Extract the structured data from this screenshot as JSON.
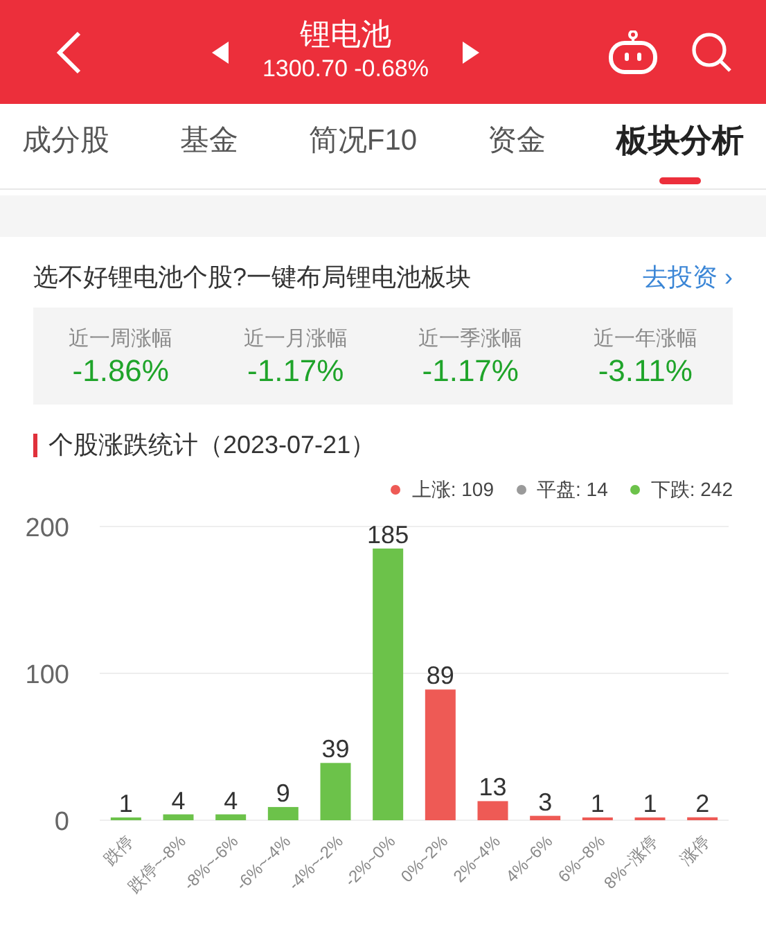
{
  "header": {
    "title": "锂电池",
    "quote": "1300.70 -0.68%"
  },
  "tabs": [
    {
      "label": "成分股",
      "selected": false
    },
    {
      "label": "基金",
      "selected": false
    },
    {
      "label": "简况F10",
      "selected": false
    },
    {
      "label": "资金",
      "selected": false
    },
    {
      "label": "板块分析",
      "selected": true
    }
  ],
  "promo": {
    "text": "选不好锂电池个股?一键布局锂电池板块",
    "link": "去投资",
    "arrow": "›"
  },
  "returns": [
    {
      "label": "近一周涨幅",
      "value": "-1.86%"
    },
    {
      "label": "近一月涨幅",
      "value": "-1.17%"
    },
    {
      "label": "近一季涨幅",
      "value": "-1.17%"
    },
    {
      "label": "近一年涨幅",
      "value": "-3.11%"
    }
  ],
  "stats": {
    "title": "个股涨跌统计（2023-07-21）",
    "legend": [
      {
        "label": "上涨: 109",
        "color": "#ee5a55"
      },
      {
        "label": "平盘: 14",
        "color": "#9a9a9a"
      },
      {
        "label": "下跌: 242",
        "color": "#6cc24a"
      }
    ],
    "chart_data": {
      "type": "bar",
      "categories": [
        "跌停",
        "跌停~-8%",
        "-8%~-6%",
        "-6%~-4%",
        "-4%~-2%",
        "-2%~0%",
        "0%~2%",
        "2%~4%",
        "4%~6%",
        "6%~8%",
        "8%~涨停",
        "涨停"
      ],
      "series": [
        {
          "color": "#6cc24a",
          "values": [
            1,
            4,
            4,
            9,
            39,
            185,
            null,
            null,
            null,
            null,
            null,
            null
          ]
        },
        {
          "color": "#ee5a55",
          "values": [
            null,
            null,
            null,
            null,
            null,
            null,
            89,
            13,
            3,
            1,
            1,
            2
          ]
        }
      ],
      "ylim": [
        0,
        200
      ],
      "yticks": [
        0,
        100,
        200
      ],
      "data_labels": true
    }
  }
}
